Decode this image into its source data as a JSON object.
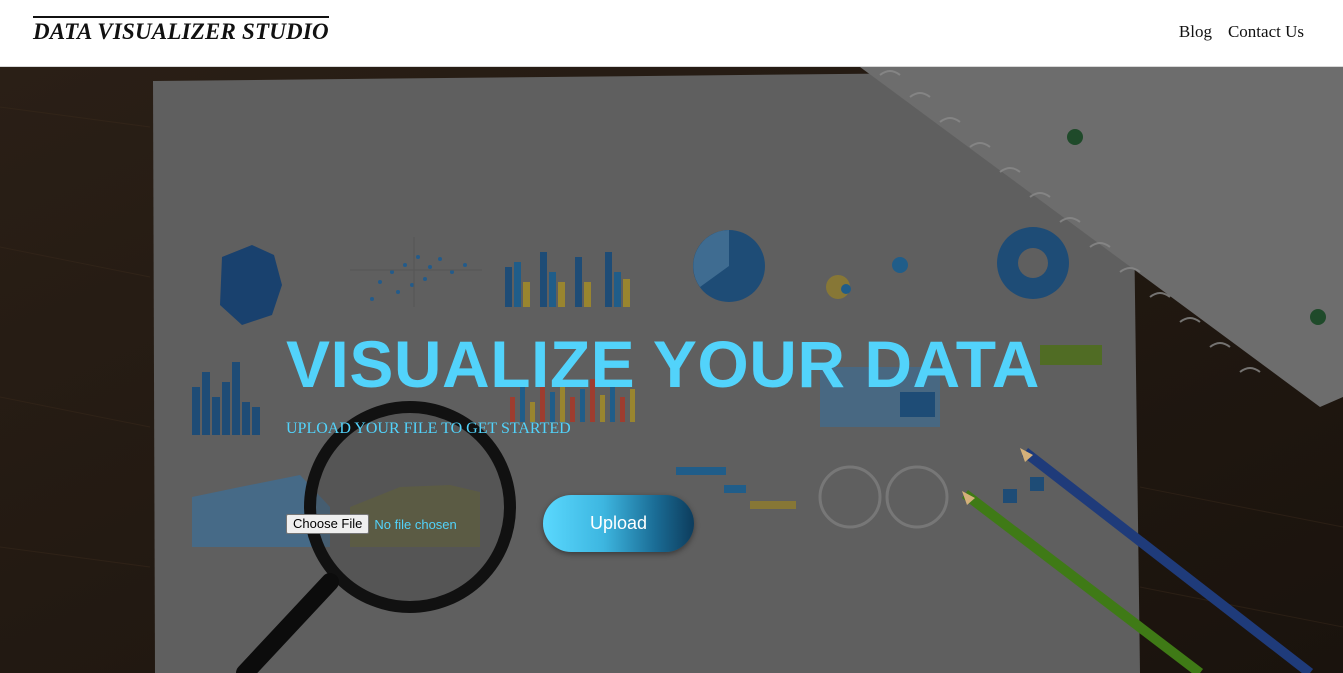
{
  "header": {
    "logo": "DATA VISUALIZER STUDIO",
    "nav": [
      {
        "label": "Blog"
      },
      {
        "label": "Contact Us"
      }
    ]
  },
  "hero": {
    "title": "VISUALIZE YOUR DATA",
    "subtitle": "UPLOAD YOUR FILE TO GET STARTED",
    "file_input": {
      "button_label": "Choose File",
      "status": "No file chosen"
    },
    "upload_label": "Upload"
  },
  "colors": {
    "accent": "#52d3fb",
    "header_bg": "#ffffff",
    "hero_bg": "#1d1712"
  }
}
